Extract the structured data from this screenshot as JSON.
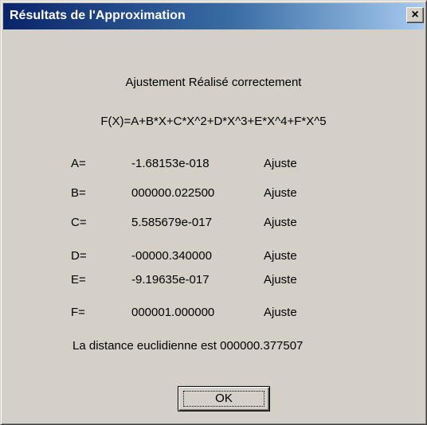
{
  "window": {
    "title": "Résultats de l'Approximation",
    "close_label": "×"
  },
  "dialog": {
    "status": "Ajustement Réalisé correctement",
    "formula": "F(X)=A+B*X+C*X^2+D*X^3+E*X^4+F*X^5",
    "coefficients": [
      {
        "name": "A=",
        "value": "-1.68153e-018",
        "status": "Ajuste"
      },
      {
        "name": "B=",
        "value": "000000.022500",
        "status": "Ajuste"
      },
      {
        "name": "C=",
        "value": "5.585679e-017",
        "status": "Ajuste"
      },
      {
        "name": "D=",
        "value": "-00000.340000",
        "status": "Ajuste"
      },
      {
        "name": "E=",
        "value": "-9.19635e-017",
        "status": "Ajuste"
      },
      {
        "name": "F=",
        "value": "000001.000000",
        "status": "Ajuste"
      }
    ],
    "distance_text": "La distance euclidienne est 000000.377507",
    "ok_label": "OK"
  }
}
